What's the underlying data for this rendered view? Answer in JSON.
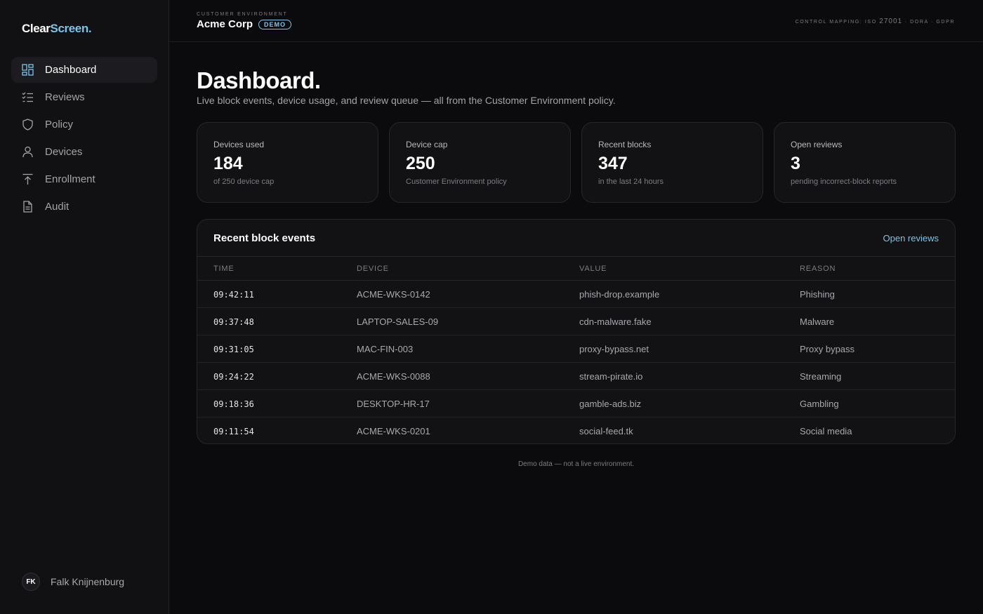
{
  "brand": {
    "part1": "Clear",
    "part2": "Screen."
  },
  "sidebar": {
    "items": [
      {
        "label": "Dashboard",
        "icon": "dashboard-icon"
      },
      {
        "label": "Reviews",
        "icon": "list-check-icon"
      },
      {
        "label": "Policy",
        "icon": "shield-icon"
      },
      {
        "label": "Devices",
        "icon": "user-icon"
      },
      {
        "label": "Enrollment",
        "icon": "upload-icon"
      },
      {
        "label": "Audit",
        "icon": "document-icon"
      }
    ],
    "active": "Dashboard"
  },
  "user": {
    "initials": "FK",
    "name": "Falk Knijnenburg"
  },
  "header": {
    "env_label": "CUSTOMER ENVIRONMENT",
    "env_name": "Acme Corp",
    "badge": "DEMO",
    "mapping_prefix": "CONTROL MAPPING: ISO",
    "mapping_iso": "27001",
    "mapping_suffix": "· DORA · GDPR"
  },
  "page": {
    "title": "Dashboard.",
    "subtitle": "Live block events, device usage, and review queue — all from the Customer Environment policy."
  },
  "stats": [
    {
      "label": "Devices used",
      "value": "184",
      "note": "of 250 device cap"
    },
    {
      "label": "Device cap",
      "value": "250",
      "note": "Customer Environment policy"
    },
    {
      "label": "Recent blocks",
      "value": "347",
      "note": "in the last 24 hours"
    },
    {
      "label": "Open reviews",
      "value": "3",
      "note": "pending incorrect-block reports"
    }
  ],
  "events": {
    "title": "Recent block events",
    "action": "Open reviews",
    "columns": [
      "TIME",
      "DEVICE",
      "VALUE",
      "REASON"
    ],
    "rows": [
      {
        "time": "09:42:11",
        "device": "ACME-WKS-0142",
        "value": "phish-drop.example",
        "reason": "Phishing"
      },
      {
        "time": "09:37:48",
        "device": "LAPTOP-SALES-09",
        "value": "cdn-malware.fake",
        "reason": "Malware"
      },
      {
        "time": "09:31:05",
        "device": "MAC-FIN-003",
        "value": "proxy-bypass.net",
        "reason": "Proxy bypass"
      },
      {
        "time": "09:24:22",
        "device": "ACME-WKS-0088",
        "value": "stream-pirate.io",
        "reason": "Streaming"
      },
      {
        "time": "09:18:36",
        "device": "DESKTOP-HR-17",
        "value": "gamble-ads.biz",
        "reason": "Gambling"
      },
      {
        "time": "09:11:54",
        "device": "ACME-WKS-0201",
        "value": "social-feed.tk",
        "reason": "Social media"
      }
    ]
  },
  "footnote": "Demo data — not a live environment.",
  "colors": {
    "accent": "#7ec4e8",
    "background": "#0b0b0d",
    "sidebar": "#111113",
    "card": "#121215"
  }
}
